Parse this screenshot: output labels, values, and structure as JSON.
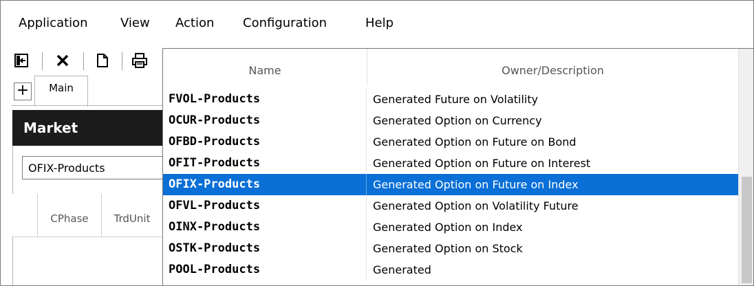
{
  "menubar": {
    "items": [
      "Application",
      "View",
      "Action",
      "Configuration",
      "Help"
    ]
  },
  "toolbar": {
    "icons": [
      "exit-icon",
      "close-icon",
      "new-document-icon",
      "print-icon"
    ]
  },
  "tabs": {
    "add_label": "+",
    "main_label": "Main"
  },
  "market": {
    "title": "Market",
    "selected_value": "OFIX-Products",
    "columns": [
      "",
      "CPhase",
      "TrdUnit"
    ]
  },
  "popup": {
    "columns": [
      "Name",
      "Owner/Description"
    ],
    "rows": [
      {
        "name": "FVOL-Products",
        "description": "Generated Future on Volatility"
      },
      {
        "name": "OCUR-Products",
        "description": "Generated Option on Currency"
      },
      {
        "name": "OFBD-Products",
        "description": "Generated Option on Future on Bond"
      },
      {
        "name": "OFIT-Products",
        "description": "Generated Option on Future on Interest"
      },
      {
        "name": "OFIX-Products",
        "description": "Generated Option on Future on Index"
      },
      {
        "name": "OFVL-Products",
        "description": "Generated Option on Volatility Future"
      },
      {
        "name": "OINX-Products",
        "description": "Generated Option on Index"
      },
      {
        "name": "OSTK-Products",
        "description": "Generated Option on Stock"
      },
      {
        "name": "POOL-Products",
        "description": "Generated"
      }
    ],
    "selected_row": 4
  },
  "colors": {
    "selection": "#0a6fd6",
    "market_header_bg": "#1c1c1c"
  }
}
